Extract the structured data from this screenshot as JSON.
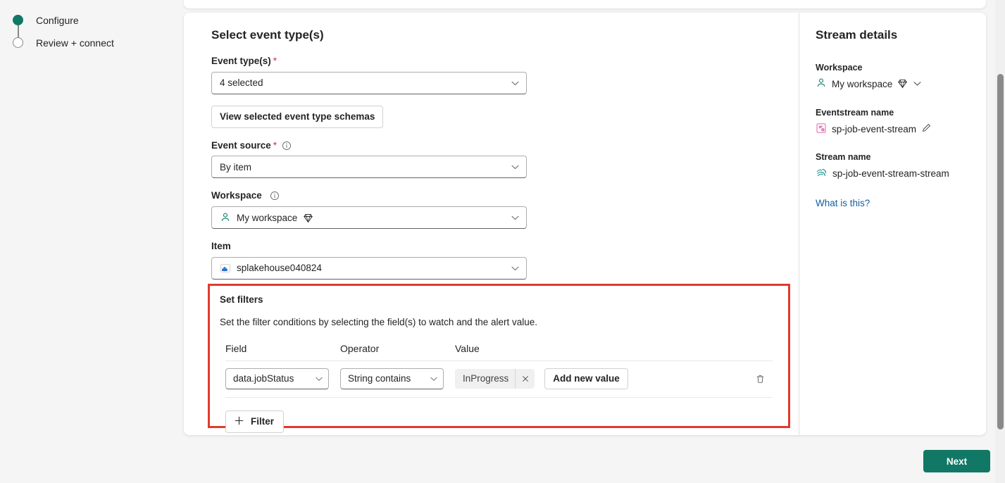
{
  "wizard": {
    "steps": [
      {
        "label": "Configure",
        "state": "active"
      },
      {
        "label": "Review + connect",
        "state": "pending"
      }
    ]
  },
  "form": {
    "section_title": "Select event type(s)",
    "event_types": {
      "label": "Event type(s)",
      "required": "*",
      "value": "4 selected",
      "chevron_icon": "chevron-down-icon"
    },
    "view_schemas_button": "View selected event type schemas",
    "event_source": {
      "label": "Event source",
      "required": "*",
      "info_icon": "info-icon",
      "value": "By item",
      "chevron_icon": "chevron-down-icon"
    },
    "workspace": {
      "label": "Workspace",
      "info_icon": "info-icon",
      "value": "My workspace",
      "person_icon": "person-icon",
      "gem_icon": "gem-icon",
      "chevron_icon": "chevron-down-icon"
    },
    "item": {
      "label": "Item",
      "value": "splakehouse040824",
      "item_icon": "lakehouse-icon",
      "chevron_icon": "chevron-down-icon"
    }
  },
  "filters": {
    "title": "Set filters",
    "description": "Set the filter conditions by selecting the field(s) to watch and the alert value.",
    "highlight_color": "#e13a2c",
    "columns": {
      "field": "Field",
      "operator": "Operator",
      "value": "Value"
    },
    "rows": [
      {
        "field": "data.jobStatus",
        "operator": "String contains",
        "value_chip": "InProgress",
        "remove_value_icon": "close-icon",
        "add_value_button": "Add new value",
        "delete_row_icon": "trash-icon"
      }
    ],
    "add_filter_button": "Filter",
    "add_filter_icon": "plus-icon"
  },
  "stream_details": {
    "title": "Stream details",
    "workspace": {
      "label": "Workspace",
      "value": "My workspace",
      "person_icon": "person-icon",
      "gem_icon": "gem-icon",
      "chevron_icon": "chevron-down-icon"
    },
    "eventstream": {
      "label": "Eventstream name",
      "value": "sp-job-event-stream",
      "item_icon": "eventstream-icon",
      "edit_icon": "pencil-icon"
    },
    "stream": {
      "label": "Stream name",
      "value": "sp-job-event-stream-stream",
      "item_icon": "stream-icon"
    },
    "help_link": "What is this?"
  },
  "footer": {
    "next_button": "Next",
    "accent_color": "#117865"
  }
}
